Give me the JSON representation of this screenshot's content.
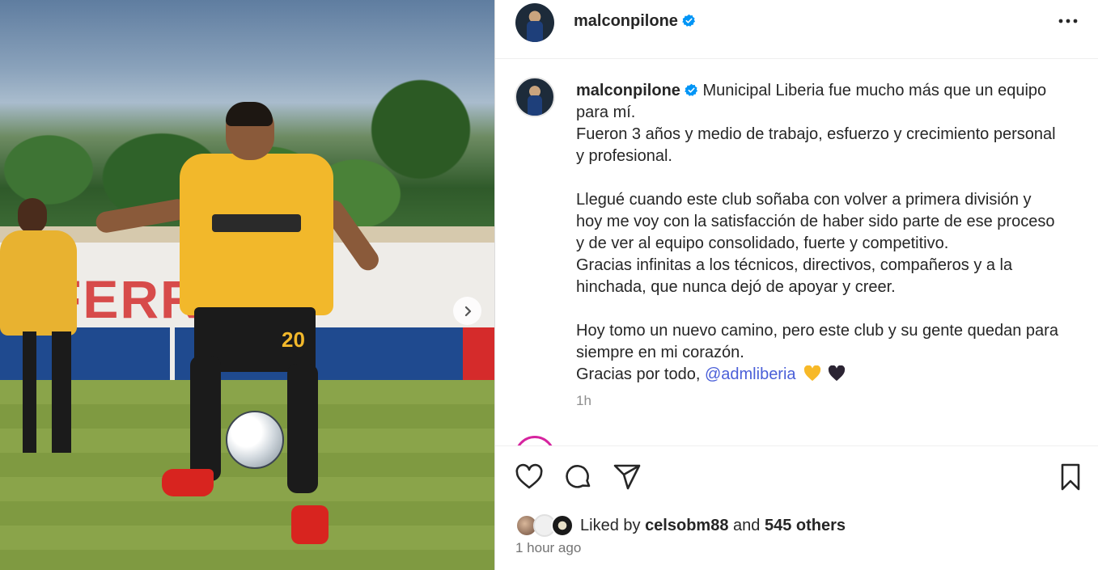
{
  "post": {
    "username": "malconpilone",
    "verified_icon": "verified-badge-icon",
    "caption_intro": " Municipal Liberia fue mucho más que un equipo para mí.\nFueron 3 años y medio de trabajo, esfuerzo y crecimiento personal y profesional.\n\nLlegué cuando este club soñaba con volver a primera división y hoy me voy con la satisfacción de haber sido parte de ese proceso y de ver al equipo consolidado, fuerte y competitivo.\nGracias infinitas a los técnicos, directivos, compañeros y a la hinchada, que nunca dejó de apoyar y creer.\n\nHoy tomo un nuevo camino, pero este club y su gente quedan para siempre en mi corazón.\nGracias por todo, ",
    "mention": "@admliberia",
    "emojis": [
      "yellow-heart",
      "black-heart"
    ],
    "caption_age": "1h"
  },
  "photo": {
    "shorts_number": "20",
    "banner_text": "FERRO  K"
  },
  "actions": {
    "icons": [
      "heart-icon",
      "comment-icon",
      "share-icon",
      "bookmark-icon"
    ]
  },
  "likes": {
    "prefix": "Liked by ",
    "user": "celsobm88",
    "middle": " and ",
    "others": "545 others"
  },
  "timestamp": "1 hour ago",
  "colors": {
    "verified": "#0095f6",
    "mention": "#4a5fd8",
    "jersey": "#f2b82b",
    "story_ring": "#d6249f"
  }
}
